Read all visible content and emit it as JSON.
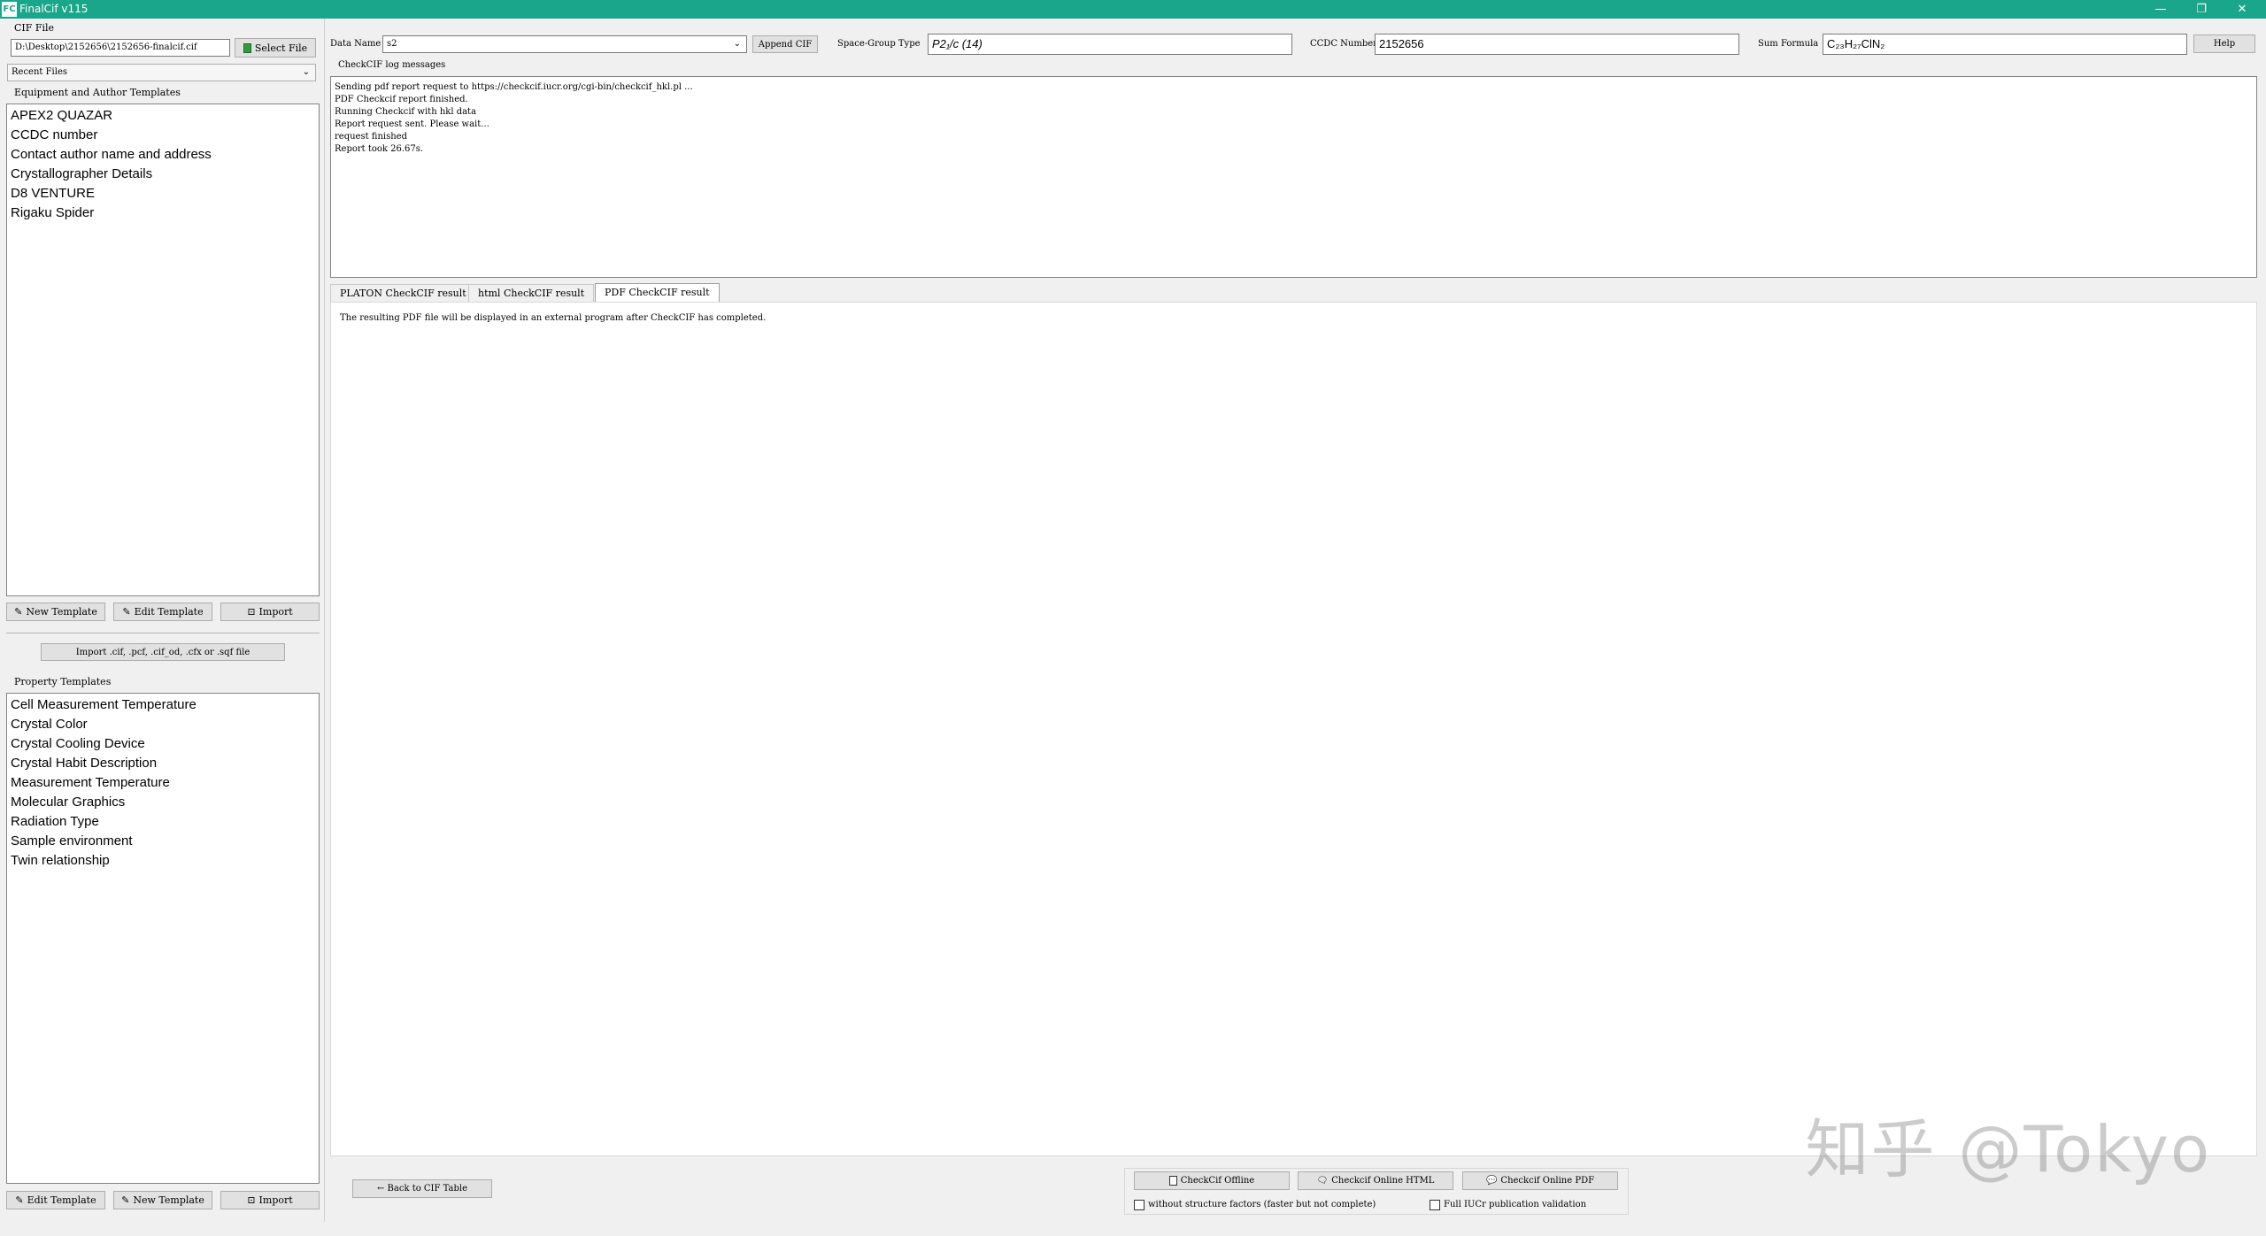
{
  "window": {
    "logo": "FC",
    "title": "FinalCif v115",
    "minimize": "—",
    "restore": "❐",
    "close": "✕"
  },
  "left": {
    "cif_file_label": "CIF File",
    "file_path": "D:\\Desktop\\2152656\\2152656-finalcif.cif",
    "select_file_button": "Select File",
    "recent_files": "Recent Files",
    "equipment_label": "Equipment and Author Templates",
    "equipment_items": [
      "APEX2 QUAZAR",
      "CCDC number",
      "Contact author name and address",
      "Crystallographer Details",
      "D8 VENTURE",
      "Rigaku Spider"
    ],
    "new_template": "New Template",
    "edit_template": "Edit Template",
    "import": "Import",
    "import_files_button": "Import .cif, .pcf, .cif_od, .cfx or .sqf file",
    "property_label": "Property Templates",
    "property_items": [
      "Cell Measurement Temperature",
      "Crystal Color",
      "Crystal Cooling Device",
      "Crystal Habit Description",
      "Measurement Temperature",
      "Molecular Graphics",
      "Radiation Type",
      "Sample environment",
      "Twin relationship"
    ],
    "edit_template_bottom": "Edit Template",
    "new_template_bottom": "New Template",
    "import_bottom": "Import"
  },
  "header": {
    "data_name_label": "Data Name",
    "data_name_value": "s2",
    "append_cif": "Append CIF",
    "space_group_label": "Space-Group Type",
    "space_group_value": "P2₁/c (14)",
    "ccdc_label": "CCDC Number",
    "ccdc_value": "2152656",
    "sum_formula_label": "Sum Formula",
    "sum_formula_value": "C₂₃H₂₇ClN₂",
    "help": "Help"
  },
  "log": {
    "label": "CheckCIF log messages",
    "lines": [
      "Sending pdf report request to https://checkcif.iucr.org/cgi-bin/checkcif_hkl.pl ...",
      "PDF Checkcif report finished.",
      "Running Checkcif with hkl data",
      "Report request sent. Please wait...",
      "request finished",
      "Report took 26.67s."
    ]
  },
  "tabs": [
    "PLATON CheckCIF result",
    "html CheckCIF result",
    "PDF CheckCIF result"
  ],
  "result_message": "The resulting PDF file will be displayed in an external program after CheckCIF has completed.",
  "footer": {
    "back_button": "← Back to CIF Table",
    "checkcif_offline": "CheckCif Offline",
    "checkcif_online_html": "Checkcif Online HTML",
    "checkcif_online_pdf": "Checkcif Online PDF",
    "without_structure_factors": "without structure factors (faster but not complete)",
    "full_iucr": "Full IUCr publication validation"
  },
  "watermark": "知乎 @Tokyo"
}
